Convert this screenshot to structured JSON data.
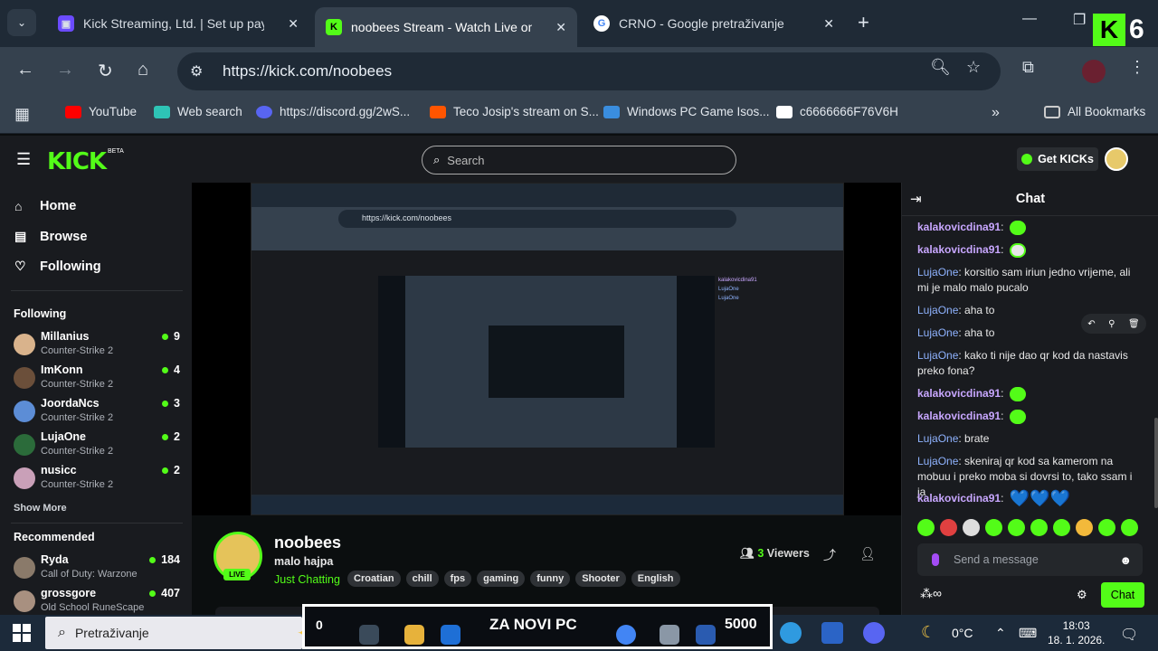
{
  "browser": {
    "tabs": [
      {
        "title": "Kick Streaming, Ltd. | Set up payments",
        "favicon_color": "#6b4bff"
      },
      {
        "title": "noobees Stream - Watch Live on Kick",
        "favicon_color": "#53fc18"
      },
      {
        "title": "CRNO - Google pretraživanje",
        "favicon_color": "#ffffff"
      }
    ],
    "url": "https://kick.com/noobees",
    "bookmarks": [
      {
        "label": "YouTube",
        "color": "#ff0000"
      },
      {
        "label": "Web search",
        "color": "#2ec4b6"
      },
      {
        "label": "https://discord.gg/2wS...",
        "color": "#5865f2"
      },
      {
        "label": "Teco Josip's stream on S...",
        "color": "#ff5500"
      },
      {
        "label": "Windows PC Game Isos...",
        "color": "#3a8dde"
      },
      {
        "label": "c6666666F76V6H",
        "color": "#ffffff"
      }
    ],
    "all_bookmarks": "All Bookmarks",
    "overlay_number": "6"
  },
  "kick": {
    "logo": "KICK",
    "beta": "BETA",
    "search_placeholder": "Search",
    "get_kicks": "Get KICKs"
  },
  "sidebar": {
    "nav": [
      {
        "label": "Home",
        "icon": "home-icon"
      },
      {
        "label": "Browse",
        "icon": "browse-icon"
      },
      {
        "label": "Following",
        "icon": "heart-icon"
      }
    ],
    "following_title": "Following",
    "following": [
      {
        "name": "Millanius",
        "game": "Counter-Strike 2",
        "viewers": "9",
        "color": "#d9b38c"
      },
      {
        "name": "ImKonn",
        "game": "Counter-Strike 2",
        "viewers": "4",
        "color": "#6b4f3a"
      },
      {
        "name": "JoordaNcs",
        "game": "Counter-Strike 2",
        "viewers": "3",
        "color": "#5c8dd6"
      },
      {
        "name": "LujaOne",
        "game": "Counter-Strike 2",
        "viewers": "2",
        "color": "#2b6b3a"
      },
      {
        "name": "nusicc",
        "game": "Counter-Strike 2",
        "viewers": "2",
        "color": "#c9a0b8"
      }
    ],
    "show_more": "Show More",
    "recommended_title": "Recommended",
    "recommended": [
      {
        "name": "Ryda",
        "game": "Call of Duty: Warzone",
        "viewers": "184",
        "color": "#8a7a6a"
      },
      {
        "name": "grossgore",
        "game": "Old School RuneScape",
        "viewers": "407",
        "color": "#a89080"
      }
    ]
  },
  "stream": {
    "name": "noobees",
    "title": "malo hajpa",
    "category": "Just Chatting",
    "tags": [
      "Croatian",
      "chill",
      "fps",
      "gaming",
      "funny",
      "Shooter",
      "English"
    ],
    "viewers_count": "3",
    "viewers_label": "Viewers",
    "live": "LIVE"
  },
  "chat": {
    "title": "Chat",
    "messages": [
      {
        "user": "kalakovicdina91",
        "text": "",
        "kind": "emote"
      },
      {
        "user": "kalakovicdina91",
        "text": "",
        "kind": "face"
      },
      {
        "user": "LujaOne",
        "text": "korsitio sam iriun jedno vrijeme, ali mi je malo malo pucalo",
        "kind": "text"
      },
      {
        "user": "LujaOne",
        "text": "aha to",
        "kind": "text"
      },
      {
        "user": "LujaOne",
        "text": "aha to",
        "kind": "text"
      },
      {
        "user": "LujaOne",
        "text": "kako ti nije dao qr kod da nastavis preko fona?",
        "kind": "text"
      },
      {
        "user": "kalakovicdina91",
        "text": "",
        "kind": "emote"
      },
      {
        "user": "kalakovicdina91",
        "text": "",
        "kind": "emote"
      },
      {
        "user": "LujaOne",
        "text": "brate",
        "kind": "text"
      },
      {
        "user": "LujaOne",
        "text": "skeniraj qr kod sa kamerom na mobuu i preko moba si dovrsi to, tako ssam i ja",
        "kind": "text"
      },
      {
        "user": "kalakovicdina91",
        "text": "💙💙💙",
        "kind": "hearts"
      }
    ],
    "send_placeholder": "Send a message",
    "send_button": "Chat"
  },
  "taskbar": {
    "search_placeholder": "Pretraživanje",
    "promo_text": "ZA NOVI PC",
    "promo_number": "5000",
    "promo_zero": "0",
    "weather": "0°C",
    "time": "18:03",
    "date": "18. 1. 2026."
  }
}
